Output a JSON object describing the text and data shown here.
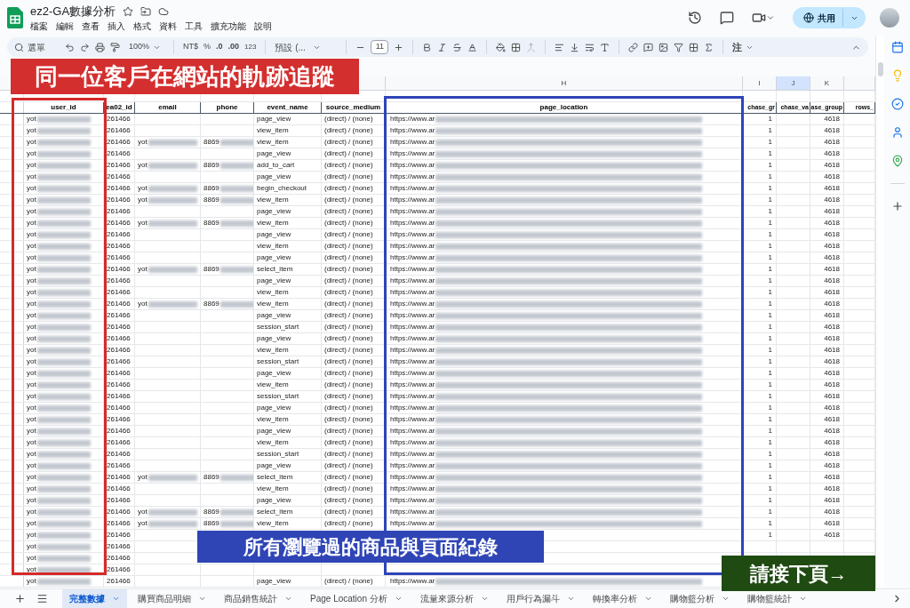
{
  "document": {
    "title": "ez2-GA數據分析"
  },
  "menu": [
    "檔案",
    "編輯",
    "查看",
    "插入",
    "格式",
    "資料",
    "工具",
    "擴充功能",
    "說明"
  ],
  "share_button": {
    "label": "共用"
  },
  "toolbar": {
    "search_placeholder": "選單",
    "zoom": "100%",
    "currency": "NT$",
    "percent": "%",
    "decrease_decimal": ".0",
    "increase_decimal": ".00",
    "number_format": "123",
    "font": "預設 (...",
    "font_size": "11",
    "notes_menu": "注"
  },
  "table": {
    "column_letters": [
      {
        "label": "H",
        "selected": false
      },
      {
        "label": "I",
        "selected": false
      },
      {
        "label": "J",
        "selected": true
      },
      {
        "label": "K",
        "selected": false
      }
    ],
    "columns": [
      {
        "label": "user_id",
        "kind": "text"
      },
      {
        "label": "ea02_id",
        "kind": "text"
      },
      {
        "label": "email",
        "kind": "text"
      },
      {
        "label": "phone",
        "kind": "text"
      },
      {
        "label": "event_name",
        "kind": "text"
      },
      {
        "label": "source_medium",
        "kind": "text"
      },
      {
        "label": "page_location",
        "kind": "text"
      },
      {
        "label": "chase_gr",
        "kind": "number"
      },
      {
        "label": "chase_va",
        "kind": "number"
      },
      {
        "label": "ase_group",
        "kind": "number"
      },
      {
        "label": "rows_",
        "kind": "number"
      }
    ],
    "rows": [
      {
        "user_id": "yot",
        "area02_id": "261466",
        "event_name": "page_view",
        "source_medium": "(direct) / (none)",
        "page_location": "https://www.ar",
        "column_8": "1",
        "column_10": "4618"
      },
      {
        "user_id": "yot",
        "area02_id": "261466",
        "event_name": "view_item",
        "source_medium": "(direct) / (none)",
        "page_location": "https://www.ar",
        "column_8": "1",
        "column_10": "4618"
      },
      {
        "user_id": "yot",
        "area02_id": "261466",
        "email": "yot",
        "phone": "8869",
        "event_name": "view_item",
        "source_medium": "(direct) / (none)",
        "page_location": "https://www.ar",
        "column_8": "1",
        "column_10": "4618"
      },
      {
        "user_id": "yot",
        "area02_id": "261466",
        "event_name": "page_view",
        "source_medium": "(direct) / (none)",
        "page_location": "https://www.ar",
        "column_8": "1",
        "column_10": "4618"
      },
      {
        "user_id": "yot",
        "area02_id": "261466",
        "email": "yot",
        "phone": "8869",
        "event_name": "add_to_cart",
        "source_medium": "(direct) / (none)",
        "page_location": "https://www.ar",
        "column_8": "1",
        "column_10": "4618"
      },
      {
        "user_id": "yot",
        "area02_id": "261466",
        "event_name": "page_view",
        "source_medium": "(direct) / (none)",
        "page_location": "https://www.ar",
        "column_8": "1",
        "column_10": "4618"
      },
      {
        "user_id": "yot",
        "area02_id": "261466",
        "email": "yot",
        "phone": "8869",
        "event_name": "begin_checkout",
        "source_medium": "(direct) / (none)",
        "page_location": "https://www.ar",
        "column_8": "1",
        "column_10": "4618"
      },
      {
        "user_id": "yot",
        "area02_id": "261466",
        "email": "yot",
        "phone": "8869",
        "event_name": "view_item",
        "source_medium": "(direct) / (none)",
        "page_location": "https://www.ar",
        "column_8": "1",
        "column_10": "4618"
      },
      {
        "user_id": "yot",
        "area02_id": "261466",
        "event_name": "page_view",
        "source_medium": "(direct) / (none)",
        "page_location": "https://www.ar",
        "column_8": "1",
        "column_10": "4618"
      },
      {
        "user_id": "yot",
        "area02_id": "261466",
        "email": "yot",
        "phone": "8869",
        "event_name": "view_item",
        "source_medium": "(direct) / (none)",
        "page_location": "https://www.ar",
        "column_8": "1",
        "column_10": "4618"
      },
      {
        "user_id": "yot",
        "area02_id": "261466",
        "event_name": "page_view",
        "source_medium": "(direct) / (none)",
        "page_location": "https://www.ar",
        "column_8": "1",
        "column_10": "4618"
      },
      {
        "user_id": "yot",
        "area02_id": "261466",
        "event_name": "view_item",
        "source_medium": "(direct) / (none)",
        "page_location": "https://www.ar",
        "column_8": "1",
        "column_10": "4618"
      },
      {
        "user_id": "yot",
        "area02_id": "261466",
        "event_name": "page_view",
        "source_medium": "(direct) / (none)",
        "page_location": "https://www.ar",
        "column_8": "1",
        "column_10": "4618"
      },
      {
        "user_id": "yot",
        "area02_id": "261466",
        "email": "yot",
        "phone": "8869",
        "event_name": "select_item",
        "source_medium": "(direct) / (none)",
        "page_location": "https://www.ar",
        "column_8": "1",
        "column_10": "4618"
      },
      {
        "user_id": "yot",
        "area02_id": "261466",
        "event_name": "page_view",
        "source_medium": "(direct) / (none)",
        "page_location": "https://www.ar",
        "column_8": "1",
        "column_10": "4618"
      },
      {
        "user_id": "yot",
        "area02_id": "261466",
        "event_name": "view_item",
        "source_medium": "(direct) / (none)",
        "page_location": "https://www.ar",
        "column_8": "1",
        "column_10": "4618"
      },
      {
        "user_id": "yot",
        "area02_id": "261466",
        "email": "yot",
        "phone": "8869",
        "event_name": "view_item",
        "source_medium": "(direct) / (none)",
        "page_location": "https://www.ar",
        "column_8": "1",
        "column_10": "4618"
      },
      {
        "user_id": "yot",
        "area02_id": "261466",
        "event_name": "page_view",
        "source_medium": "(direct) / (none)",
        "page_location": "https://www.ar",
        "column_8": "1",
        "column_10": "4618"
      },
      {
        "user_id": "yot",
        "area02_id": "261466",
        "event_name": "session_start",
        "source_medium": "(direct) / (none)",
        "page_location": "https://www.ar",
        "column_8": "1",
        "column_10": "4618"
      },
      {
        "user_id": "yot",
        "area02_id": "261466",
        "event_name": "page_view",
        "source_medium": "(direct) / (none)",
        "page_location": "https://www.ar",
        "column_8": "1",
        "column_10": "4618"
      },
      {
        "user_id": "yot",
        "area02_id": "261466",
        "event_name": "view_item",
        "source_medium": "(direct) / (none)",
        "page_location": "https://www.ar",
        "column_8": "1",
        "column_10": "4618"
      },
      {
        "user_id": "yot",
        "area02_id": "261466",
        "event_name": "session_start",
        "source_medium": "(direct) / (none)",
        "page_location": "https://www.ar",
        "column_8": "1",
        "column_10": "4618"
      },
      {
        "user_id": "yot",
        "area02_id": "261466",
        "event_name": "page_view",
        "source_medium": "(direct) / (none)",
        "page_location": "https://www.ar",
        "column_8": "1",
        "column_10": "4618"
      },
      {
        "user_id": "yot",
        "area02_id": "261466",
        "event_name": "view_item",
        "source_medium": "(direct) / (none)",
        "page_location": "https://www.ar",
        "column_8": "1",
        "column_10": "4618"
      },
      {
        "user_id": "yot",
        "area02_id": "261466",
        "event_name": "session_start",
        "source_medium": "(direct) / (none)",
        "page_location": "https://www.ar",
        "column_8": "1",
        "column_10": "4618"
      },
      {
        "user_id": "yot",
        "area02_id": "261466",
        "event_name": "page_view",
        "source_medium": "(direct) / (none)",
        "page_location": "https://www.ar",
        "column_8": "1",
        "column_10": "4618"
      },
      {
        "user_id": "yot",
        "area02_id": "261466",
        "event_name": "view_item",
        "source_medium": "(direct) / (none)",
        "page_location": "https://www.ar",
        "column_8": "1",
        "column_10": "4618"
      },
      {
        "user_id": "yot",
        "area02_id": "261466",
        "event_name": "page_view",
        "source_medium": "(direct) / (none)",
        "page_location": "https://www.ar",
        "column_8": "1",
        "column_10": "4618"
      },
      {
        "user_id": "yot",
        "area02_id": "261466",
        "event_name": "view_item",
        "source_medium": "(direct) / (none)",
        "page_location": "https://www.ar",
        "column_8": "1",
        "column_10": "4618"
      },
      {
        "user_id": "yot",
        "area02_id": "261466",
        "event_name": "session_start",
        "source_medium": "(direct) / (none)",
        "page_location": "https://www.ar",
        "column_8": "1",
        "column_10": "4618"
      },
      {
        "user_id": "yot",
        "area02_id": "261466",
        "event_name": "page_view",
        "source_medium": "(direct) / (none)",
        "page_location": "https://www.ar",
        "column_8": "1",
        "column_10": "4618"
      },
      {
        "user_id": "yot",
        "area02_id": "261466",
        "email": "yot",
        "phone": "8869",
        "event_name": "select_item",
        "source_medium": "(direct) / (none)",
        "page_location": "https://www.ar",
        "column_8": "1",
        "column_10": "4618"
      },
      {
        "user_id": "yot",
        "area02_id": "261466",
        "event_name": "view_item",
        "source_medium": "(direct) / (none)",
        "page_location": "https://www.ar",
        "column_8": "1",
        "column_10": "4618"
      },
      {
        "user_id": "yot",
        "area02_id": "261466",
        "event_name": "page_view",
        "source_medium": "(direct) / (none)",
        "page_location": "https://www.ar",
        "column_8": "1",
        "column_10": "4618"
      },
      {
        "user_id": "yot",
        "area02_id": "261466",
        "email": "yot",
        "phone": "8869",
        "event_name": "select_item",
        "source_medium": "(direct) / (none)",
        "page_location": "https://www.ar",
        "column_8": "1",
        "column_10": "4618"
      },
      {
        "user_id": "yot",
        "area02_id": "261466",
        "email": "yot",
        "phone": "8869",
        "event_name": "view_item",
        "source_medium": "(direct) / (none)",
        "page_location": "https://www.ar",
        "column_8": "1",
        "column_10": "4618"
      },
      {
        "user_id": "yot",
        "area02_id": "261466",
        "column_8": "1",
        "column_10": "4618"
      },
      {
        "user_id": "yot",
        "area02_id": "261466"
      },
      {
        "user_id": "yot",
        "area02_id": "261466"
      },
      {
        "user_id": "yot",
        "area02_id": "261466"
      },
      {
        "user_id": "yot",
        "area02_id": "261466",
        "event_name": "page_view",
        "source_medium": "(direct) / (none)",
        "page_location": "https://www.ar"
      }
    ]
  },
  "sheet_tabs": [
    {
      "label": "完整數據",
      "selected": true
    },
    {
      "label": "購買商品明細",
      "selected": false
    },
    {
      "label": "商品銷售統計",
      "selected": false
    },
    {
      "label": "Page Location 分析",
      "selected": false
    },
    {
      "label": "流量來源分析",
      "selected": false
    },
    {
      "label": "用戶行為漏斗",
      "selected": false
    },
    {
      "label": "轉換率分析",
      "selected": false
    },
    {
      "label": "購物籃分析",
      "selected": false
    },
    {
      "label": "購物籃統計",
      "selected": false
    }
  ],
  "annotations": [
    {
      "text": "同一位客戶在網站的軌跡追蹤",
      "color": "#d32f2f"
    },
    {
      "text": "所有瀏覽過的商品與頁面紀錄",
      "color": "#2f45b5"
    },
    {
      "text": "請接下頁→",
      "color": "#1f4a12"
    }
  ],
  "highlight_frames": [
    {
      "color": "#d42a2a"
    },
    {
      "color": "#2e44b8"
    }
  ]
}
